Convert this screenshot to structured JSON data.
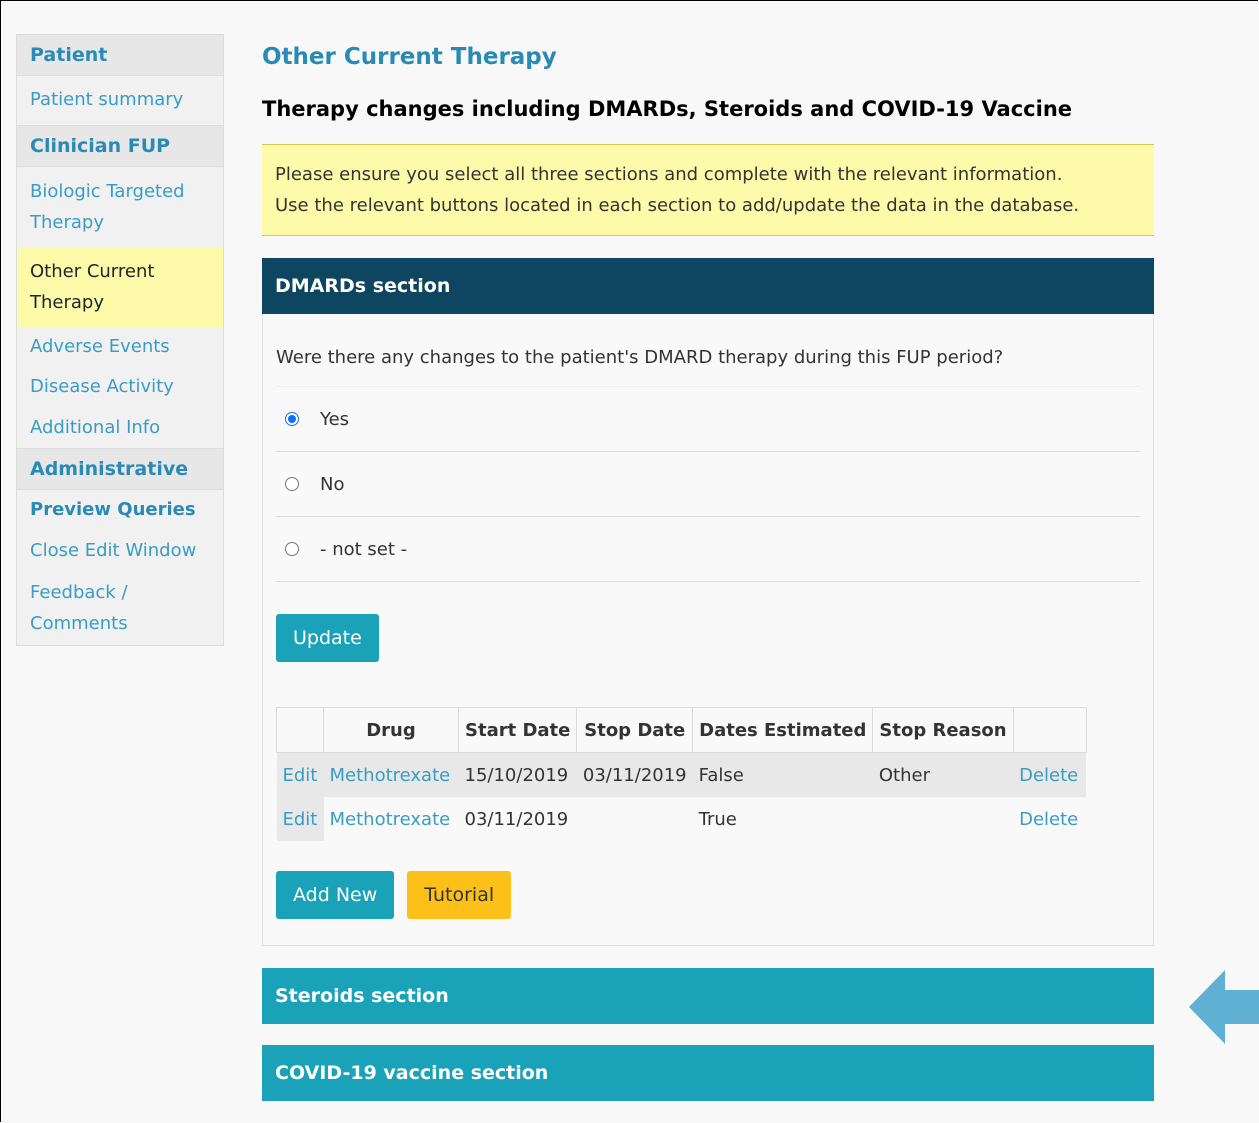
{
  "sidebar": {
    "sections": [
      {
        "heading": "Patient",
        "items": [
          {
            "label": "Patient summary",
            "active": false
          }
        ]
      },
      {
        "heading": "Clinician FUP",
        "items": [
          {
            "label": "Biologic Targeted Therapy"
          },
          {
            "label": "Other Current Therapy"
          },
          {
            "label": "Adverse Events"
          },
          {
            "label": "Disease Activity"
          },
          {
            "label": "Additional Info"
          }
        ]
      },
      {
        "heading": "Administrative",
        "items": [
          {
            "label": "Preview Queries"
          },
          {
            "label": "Close Edit Window"
          },
          {
            "label": "Feedback / Comments"
          }
        ]
      }
    ]
  },
  "main": {
    "title": "Other Current Therapy",
    "subtitle": "Therapy changes including DMARDs, Steroids and COVID-19 Vaccine",
    "notice": {
      "line1": "Please ensure you select all three sections and complete with the relevant information.",
      "line2": "Use the relevant buttons located in each section to add/update the data in the database."
    },
    "dmards": {
      "heading": "DMARDs section",
      "question": "Were there any changes to the patient's DMARD therapy during this FUP period?",
      "options": [
        "Yes",
        "No",
        "- not set -"
      ],
      "selected": "Yes",
      "update_label": "Update",
      "table": {
        "headers": [
          "",
          "Drug",
          "Start Date",
          "Stop Date",
          "Dates Estimated",
          "Stop Reason",
          ""
        ],
        "rows": [
          {
            "edit": "Edit",
            "drug": "Methotrexate",
            "start": "15/10/2019",
            "stop": "03/11/2019",
            "estimated": "False",
            "reason": "Other",
            "delete": "Delete"
          },
          {
            "edit": "Edit",
            "drug": "Methotrexate",
            "start": "03/11/2019",
            "stop": "",
            "estimated": "True",
            "reason": "",
            "delete": "Delete"
          }
        ]
      },
      "add_new_label": "Add New",
      "tutorial_label": "Tutorial"
    },
    "steroids_heading": "Steroids section",
    "covid_heading": "COVID-19 vaccine section"
  },
  "colors": {
    "accent": "#2a8ab6",
    "dark_header": "#0e4560",
    "teal": "#1aa2b8",
    "highlight": "#fdfbaa",
    "warning_button": "#fcc118",
    "arrow": "#5fb0d2"
  }
}
